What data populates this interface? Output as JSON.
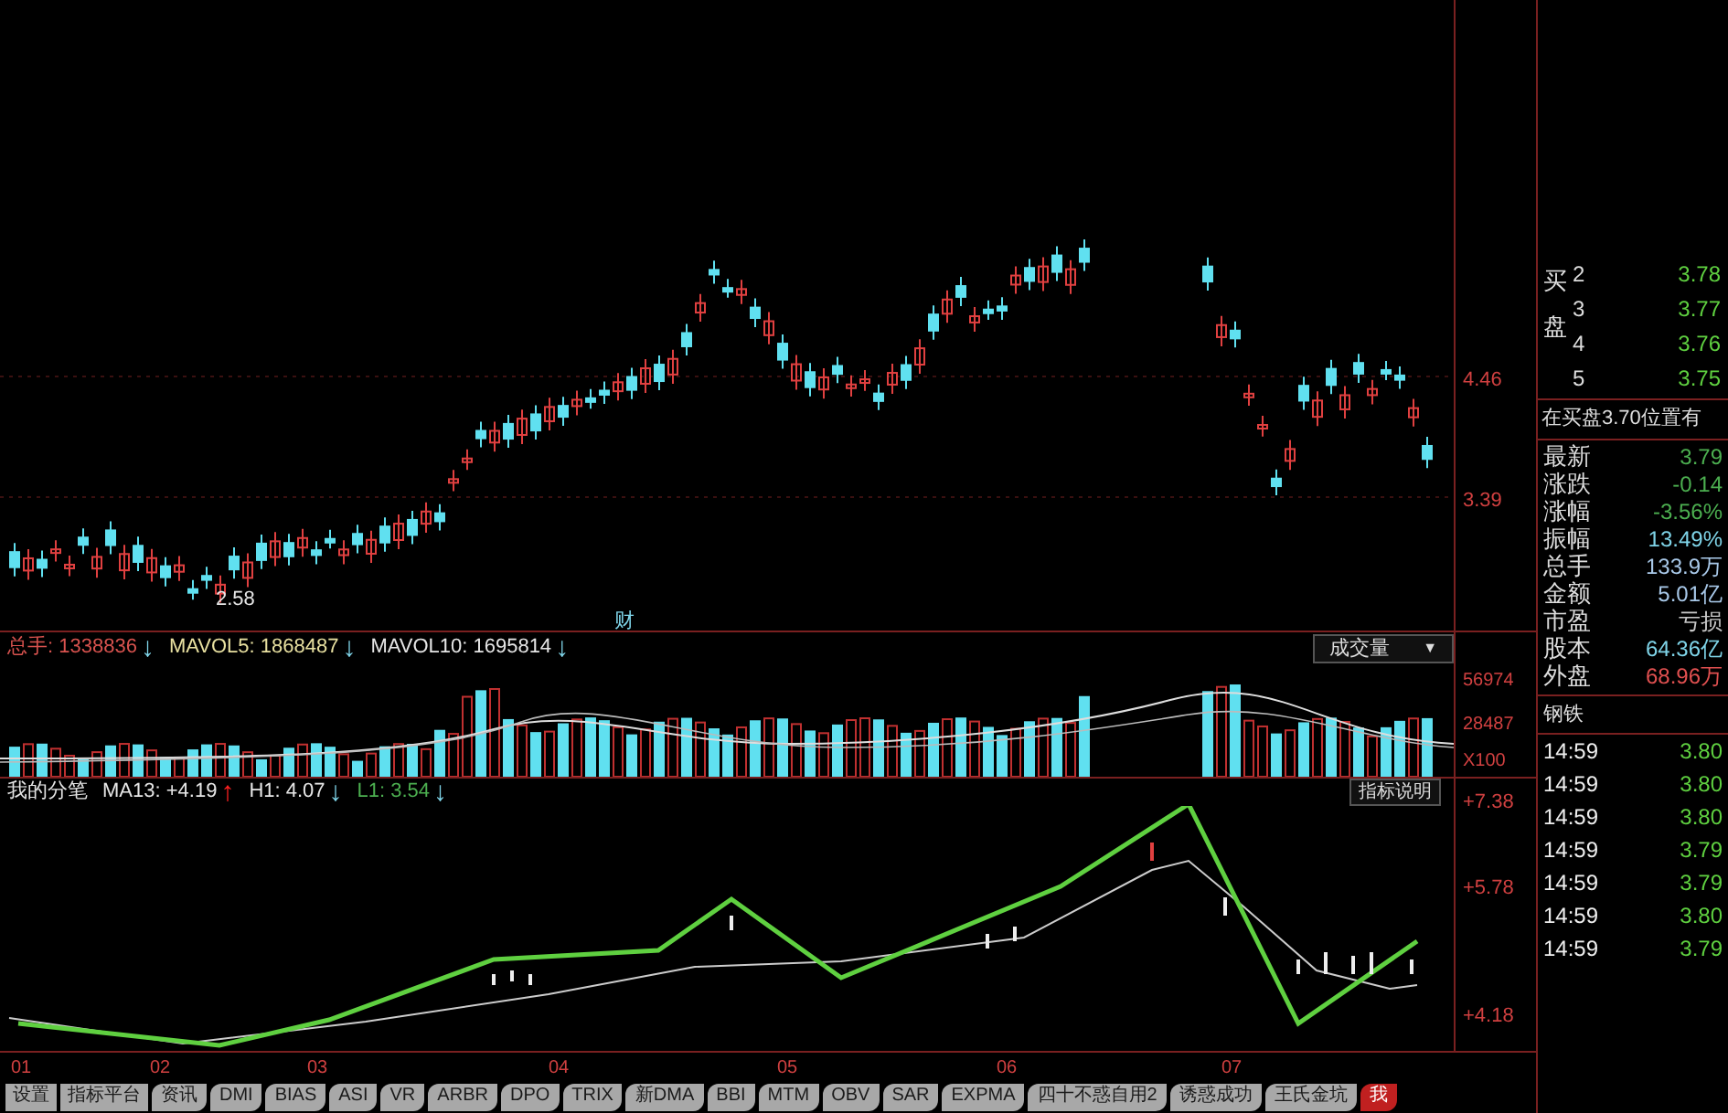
{
  "price_chart": {
    "axis_labels": [
      "4.46",
      "3.39"
    ],
    "low_marker": "2.58",
    "event_marker": "财"
  },
  "volume_header": [
    {
      "label": "总手: 1338836",
      "arrow": {
        "glyph": "↓",
        "color": "#7fd4e8"
      },
      "color": "#d9534f"
    },
    {
      "label": "MAVOL5: 1868487",
      "arrow": {
        "glyph": "↓",
        "color": "#7fd4e8"
      },
      "color": "#e8e0a0"
    },
    {
      "label": "MAVOL10: 1695814",
      "arrow": {
        "glyph": "↓",
        "color": "#7fd4e8"
      },
      "color": "#e6e6e6"
    }
  ],
  "volume_selector": {
    "value": "成交量",
    "caret": "▼"
  },
  "volume_axis": [
    "56974",
    "28487",
    "X100"
  ],
  "indicator_header": [
    {
      "label": "我的分笔",
      "color": "#e6e6e6"
    },
    {
      "label": "MA13: +4.19",
      "arrow": {
        "glyph": "↑",
        "color": "#ff2020"
      },
      "color": "#e6e6e6"
    },
    {
      "label": "H1: 4.07",
      "arrow": {
        "glyph": "↓",
        "color": "#7fd4e8"
      },
      "color": "#e6e6e6"
    },
    {
      "label": "L1: 3.54",
      "arrow": {
        "glyph": "↓",
        "color": "#7fd4e8"
      },
      "color": "#4caf50"
    }
  ],
  "indicator_button": "指标说明",
  "indicator_axis": [
    "+7.38",
    "+5.78",
    "+4.18"
  ],
  "dates": [
    "01",
    "02",
    "03",
    "04",
    "05",
    "06",
    "07"
  ],
  "tabs": [
    {
      "label": "设置",
      "kind": "button",
      "selected": false
    },
    {
      "label": "指标平台",
      "kind": "button",
      "selected": false
    },
    {
      "label": "资讯",
      "kind": "tab",
      "selected": false
    },
    {
      "label": "DMI",
      "kind": "tab",
      "selected": false
    },
    {
      "label": "BIAS",
      "kind": "tab",
      "selected": false
    },
    {
      "label": "ASI",
      "kind": "tab",
      "selected": false
    },
    {
      "label": "VR",
      "kind": "tab",
      "selected": false
    },
    {
      "label": "ARBR",
      "kind": "tab",
      "selected": false
    },
    {
      "label": "DPO",
      "kind": "tab",
      "selected": false
    },
    {
      "label": "TRIX",
      "kind": "tab",
      "selected": false
    },
    {
      "label": "新DMA",
      "kind": "tab",
      "selected": false
    },
    {
      "label": "BBI",
      "kind": "tab",
      "selected": false
    },
    {
      "label": "MTM",
      "kind": "tab",
      "selected": false
    },
    {
      "label": "OBV",
      "kind": "tab",
      "selected": false
    },
    {
      "label": "SAR",
      "kind": "tab",
      "selected": false
    },
    {
      "label": "EXPMA",
      "kind": "tab",
      "selected": false
    },
    {
      "label": "四十不惑自用2",
      "kind": "tab",
      "selected": false
    },
    {
      "label": "诱惑成功",
      "kind": "tab",
      "selected": false
    },
    {
      "label": "王氏金坑",
      "kind": "tab",
      "selected": false
    },
    {
      "label": "我",
      "kind": "tab",
      "selected": true
    }
  ],
  "order_book": {
    "side_label": "买盘",
    "levels": [
      {
        "rank": "2",
        "price": "3.78"
      },
      {
        "rank": "3",
        "price": "3.77"
      },
      {
        "rank": "4",
        "price": "3.76"
      },
      {
        "rank": "5",
        "price": "3.75"
      }
    ],
    "notice": "在买盘3.70位置有"
  },
  "stats": [
    {
      "label": "最新",
      "value": "3.79",
      "color": "#4caf50"
    },
    {
      "label": "涨跌",
      "value": "-0.14",
      "color": "#4caf50"
    },
    {
      "label": "涨幅",
      "value": "-3.56%",
      "color": "#4caf50"
    },
    {
      "label": "振幅",
      "value": "13.49%",
      "color": "#7fd4e8"
    },
    {
      "label": "总手",
      "value": "133.9万",
      "color": "#a8c8e8"
    },
    {
      "label": "金额",
      "value": "5.01亿",
      "color": "#a8c8e8"
    },
    {
      "label": "市盈",
      "value": "亏损",
      "color": "#c8c8c8"
    },
    {
      "label": "股本",
      "value": "64.36亿",
      "color": "#7fd4e8"
    },
    {
      "label": "外盘",
      "value": "68.96万",
      "color": "#e05050"
    }
  ],
  "sector": "钢铁",
  "trades": [
    {
      "time": "14:59",
      "price": "3.80"
    },
    {
      "time": "14:59",
      "price": "3.80"
    },
    {
      "time": "14:59",
      "price": "3.80"
    },
    {
      "time": "14:59",
      "price": "3.79"
    },
    {
      "time": "14:59",
      "price": "3.79"
    },
    {
      "time": "14:59",
      "price": "3.80"
    },
    {
      "time": "14:59",
      "price": "3.79"
    }
  ]
}
